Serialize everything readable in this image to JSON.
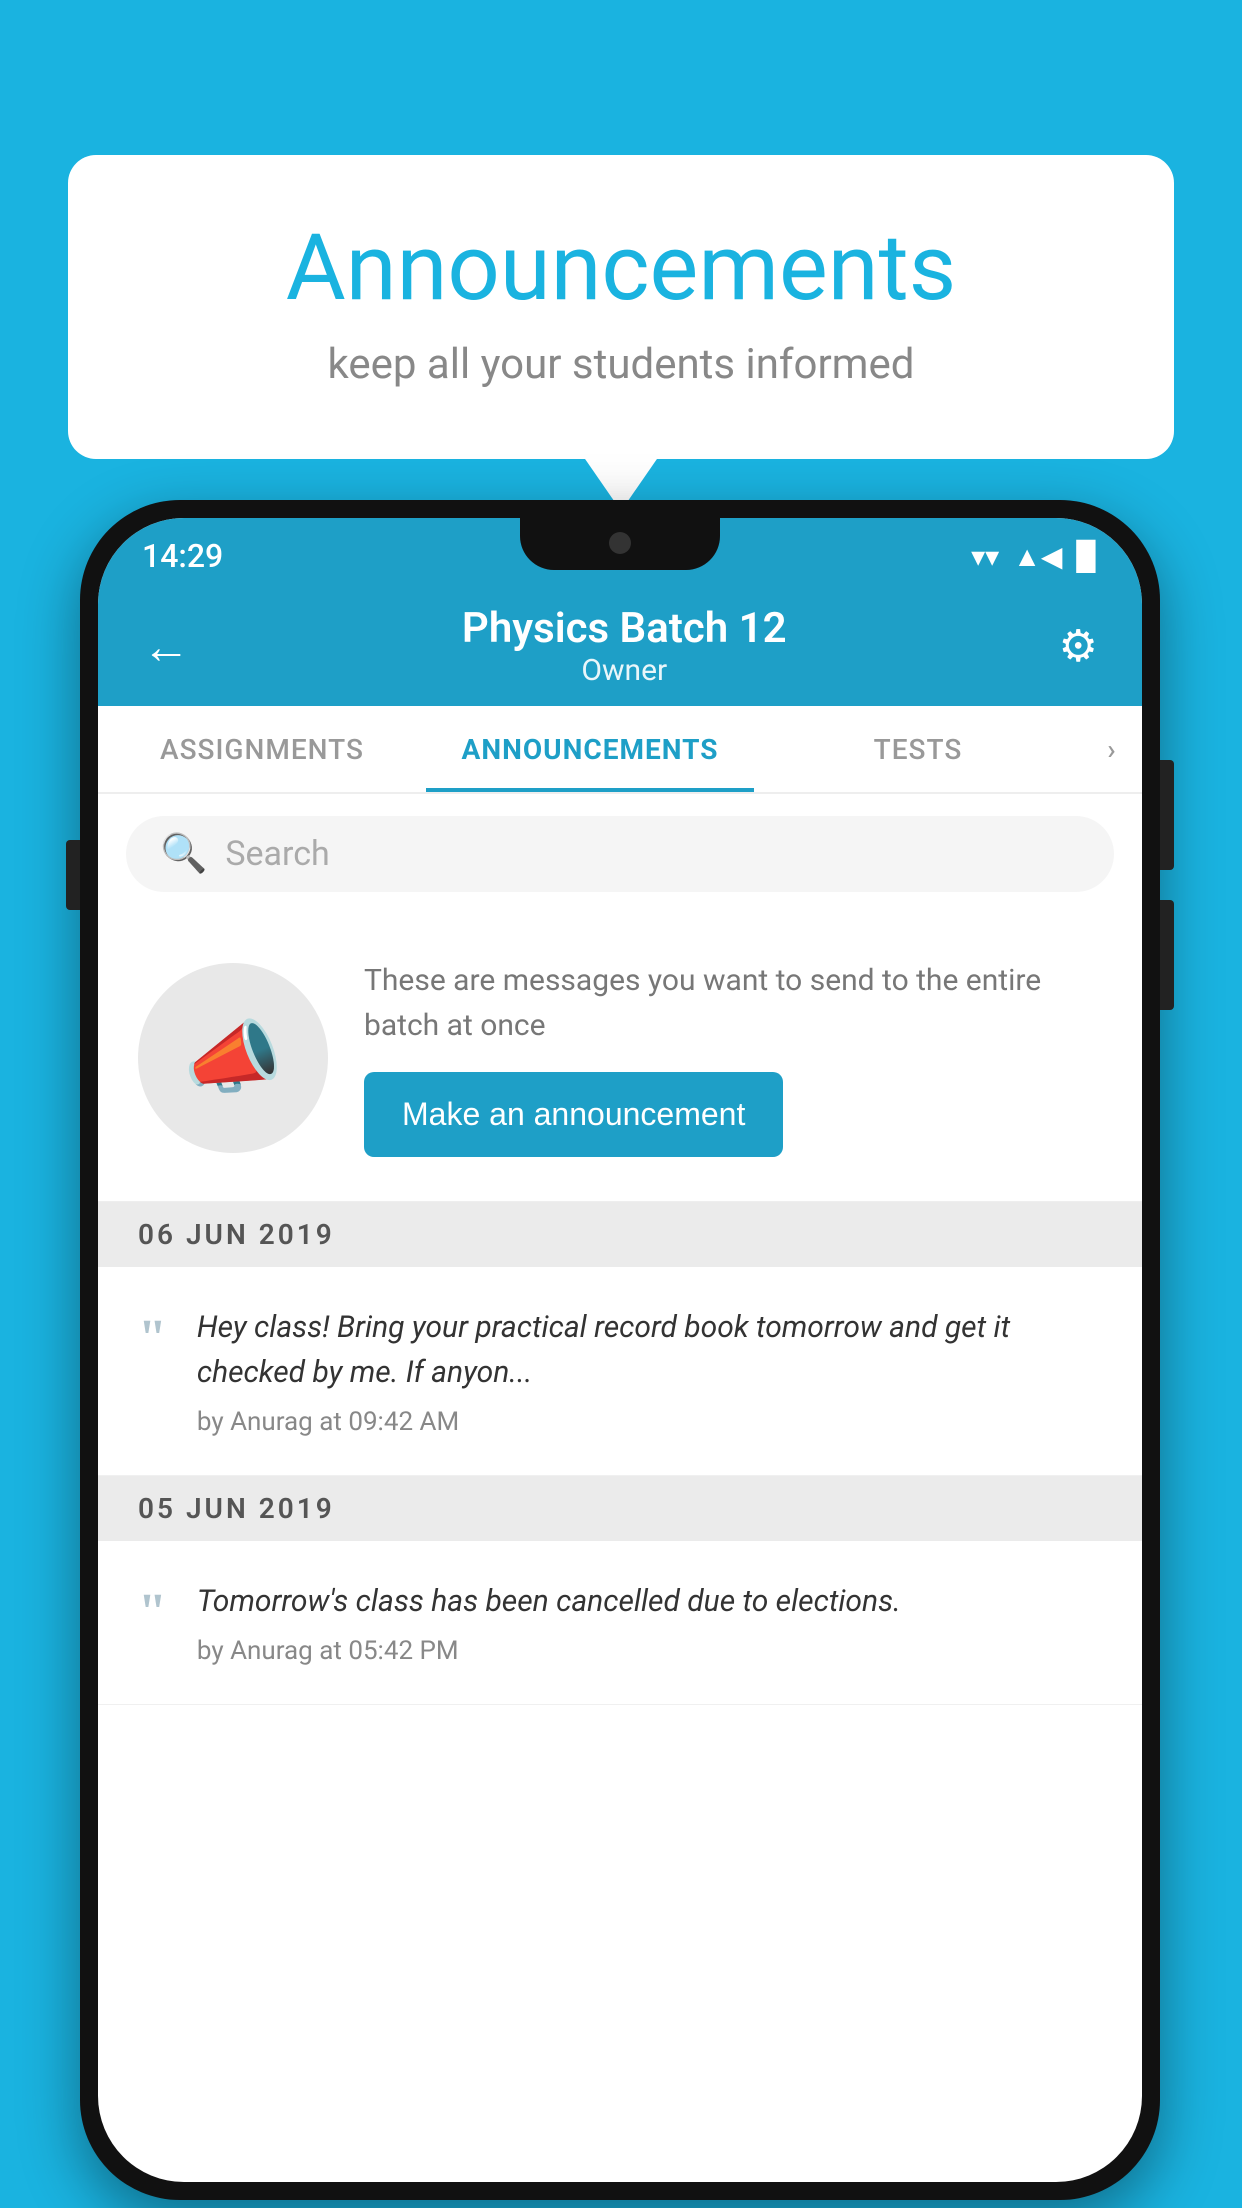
{
  "background_color": "#1ab3e0",
  "speech_bubble": {
    "title": "Announcements",
    "subtitle": "keep all your students informed"
  },
  "phone": {
    "status_bar": {
      "time": "14:29",
      "wifi": "▼",
      "signal": "▲",
      "battery": "▉"
    },
    "header": {
      "title": "Physics Batch 12",
      "subtitle": "Owner",
      "back_label": "←",
      "gear_label": "⚙"
    },
    "tabs": [
      {
        "label": "ASSIGNMENTS",
        "active": false
      },
      {
        "label": "ANNOUNCEMENTS",
        "active": true
      },
      {
        "label": "TESTS",
        "active": false
      },
      {
        "label": "·",
        "active": false
      }
    ],
    "search": {
      "placeholder": "Search"
    },
    "promo": {
      "description": "These are messages you want to send to the entire batch at once",
      "button_label": "Make an announcement"
    },
    "announcements": [
      {
        "date": "06  JUN  2019",
        "text": "Hey class! Bring your practical record book tomorrow and get it checked by me. If anyon...",
        "author": "by Anurag at 09:42 AM"
      },
      {
        "date": "05  JUN  2019",
        "text": "Tomorrow's class has been cancelled due to elections.",
        "author": "by Anurag at 05:42 PM"
      }
    ]
  }
}
